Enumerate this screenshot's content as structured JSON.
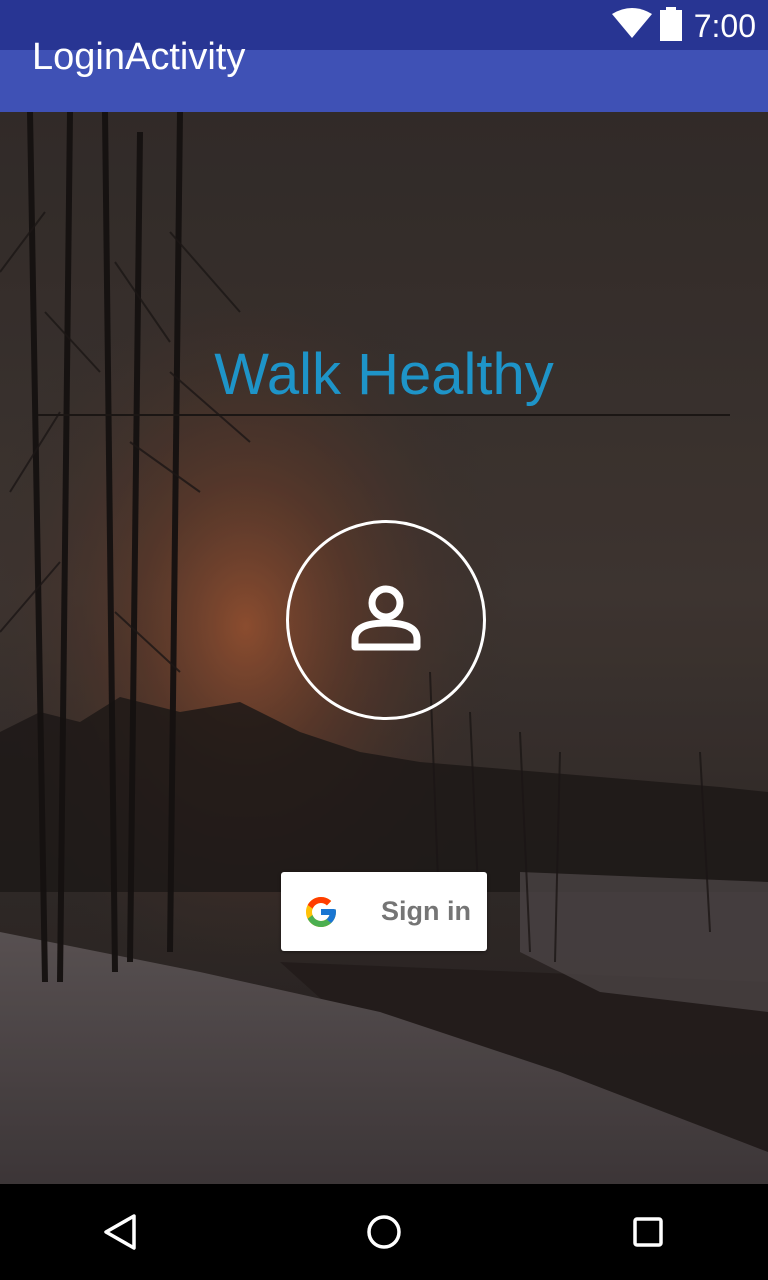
{
  "status_bar": {
    "time": "7:00",
    "icons": [
      "wifi-icon",
      "battery-icon"
    ]
  },
  "app_bar": {
    "title": "LoginActivity",
    "color": "#3f51b5"
  },
  "main": {
    "headline": "Walk Healthy",
    "headline_color": "#1e94c8",
    "avatar_icon": "person-icon",
    "signin_button": {
      "label": "Sign in",
      "icon": "google-icon"
    }
  },
  "nav_bar": {
    "buttons": [
      "back-icon",
      "home-icon",
      "recents-icon"
    ]
  }
}
